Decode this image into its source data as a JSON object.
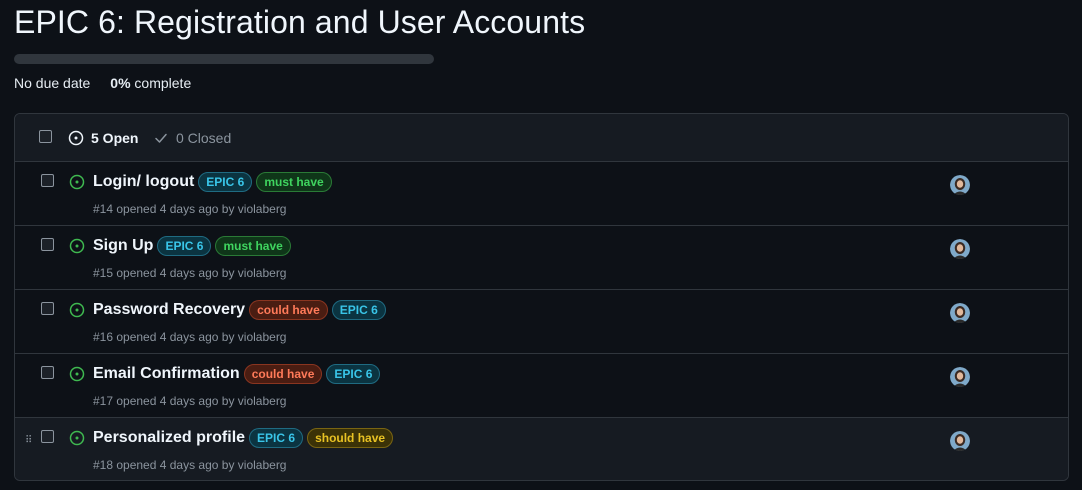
{
  "milestone": {
    "title": "EPIC 6: Registration and User Accounts",
    "progress_percent": 0,
    "due_date_text": "No due date",
    "complete_percent_text": "0%",
    "complete_suffix": "complete"
  },
  "tabs": {
    "open_label": "5 Open",
    "closed_label": "0 Closed"
  },
  "colors": {
    "epic": "#39c5e8",
    "must_have": "#3fd45f",
    "could_have": "#ff7a59",
    "should_have": "#e8c224",
    "open_icon": "#3fb950"
  },
  "issues": [
    {
      "title": "Login/ logout",
      "labels": [
        {
          "text": "EPIC 6",
          "kind": "epic"
        },
        {
          "text": "must have",
          "kind": "must"
        }
      ],
      "meta": "#14 opened 4 days ago by violaberg"
    },
    {
      "title": "Sign Up",
      "labels": [
        {
          "text": "EPIC 6",
          "kind": "epic"
        },
        {
          "text": "must have",
          "kind": "must"
        }
      ],
      "meta": "#15 opened 4 days ago by violaberg"
    },
    {
      "title": "Password Recovery",
      "labels": [
        {
          "text": "could have",
          "kind": "could"
        },
        {
          "text": "EPIC 6",
          "kind": "epic"
        }
      ],
      "meta": "#16 opened 4 days ago by violaberg"
    },
    {
      "title": "Email Confirmation",
      "labels": [
        {
          "text": "could have",
          "kind": "could"
        },
        {
          "text": "EPIC 6",
          "kind": "epic"
        }
      ],
      "meta": "#17 opened 4 days ago by violaberg"
    },
    {
      "title": "Personalized profile",
      "labels": [
        {
          "text": "EPIC 6",
          "kind": "epic"
        },
        {
          "text": "should have",
          "kind": "should"
        }
      ],
      "meta": "#18 opened 4 days ago by violaberg"
    }
  ]
}
